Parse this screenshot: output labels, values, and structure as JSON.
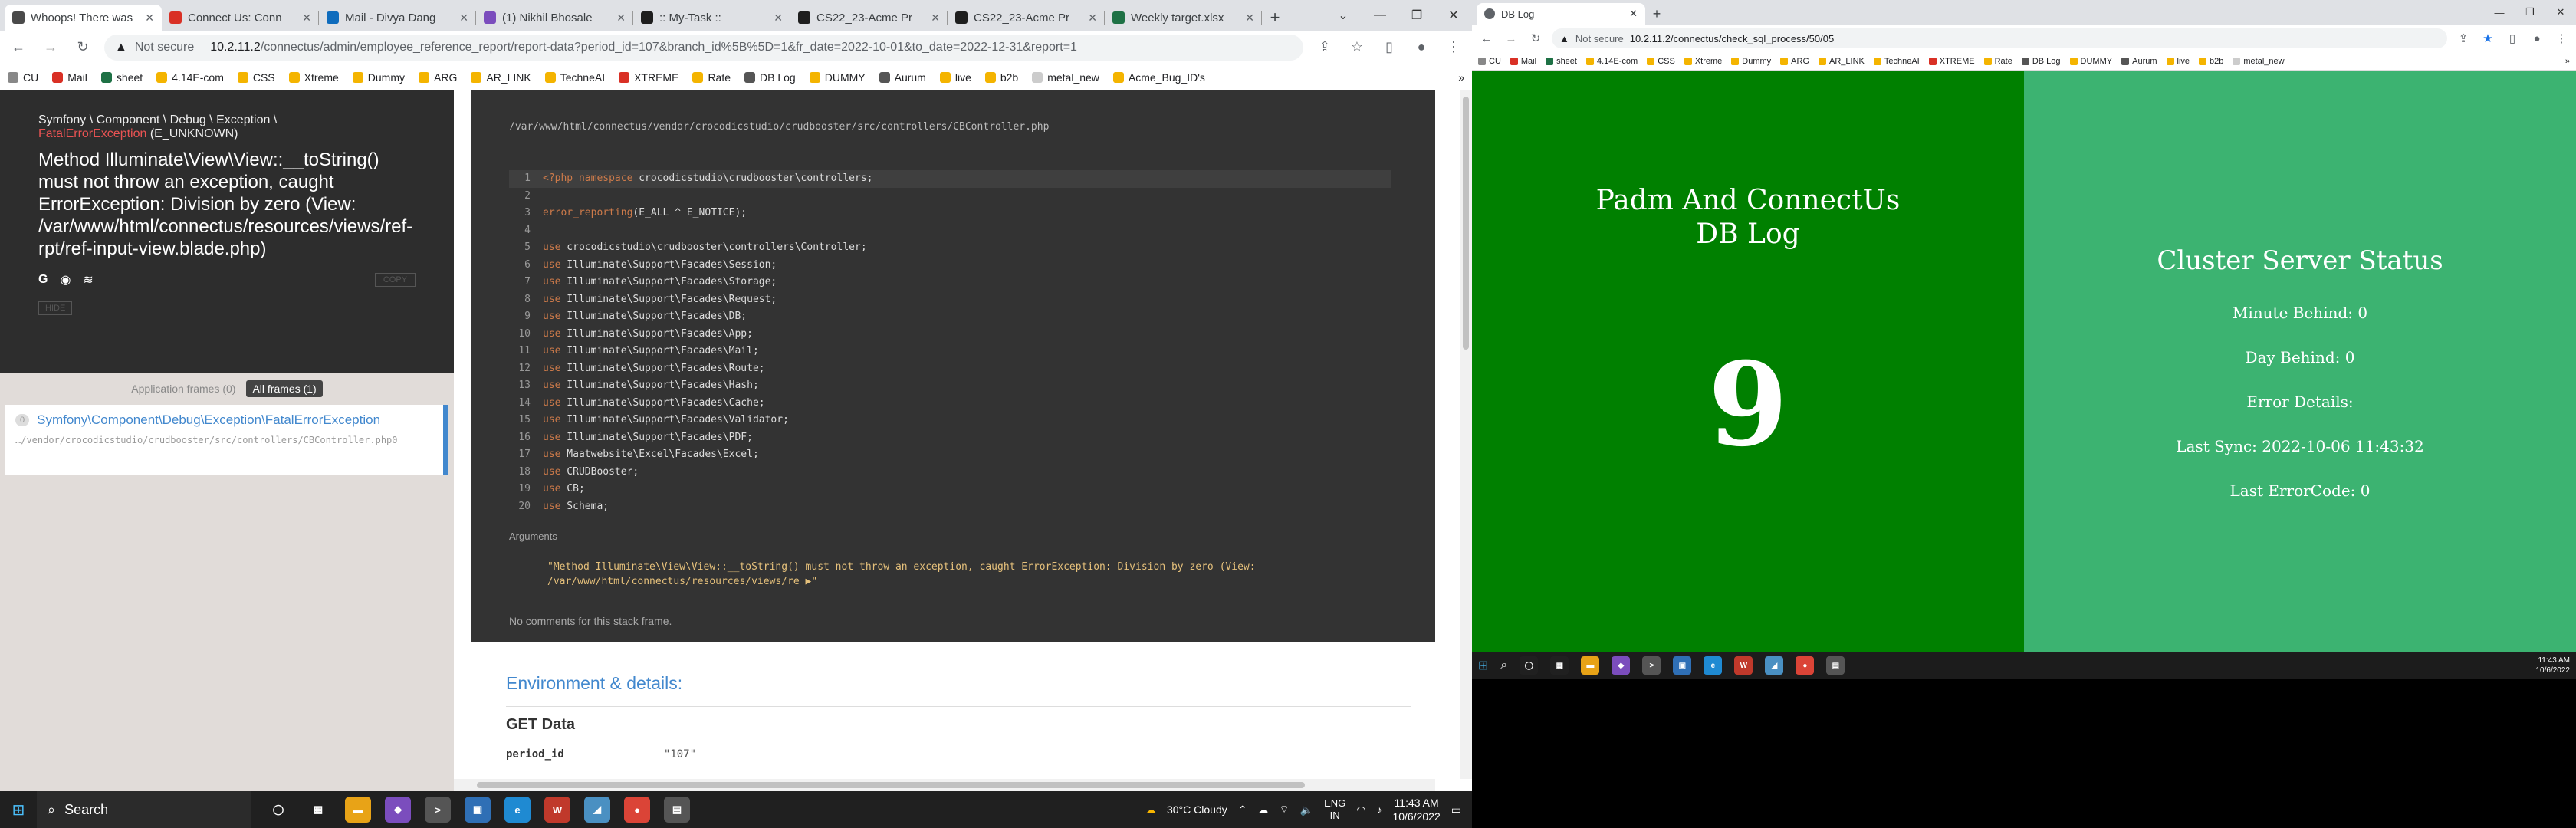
{
  "left_browser": {
    "tabs": [
      {
        "title": "Whoops! There was",
        "color": "#4a4a4a",
        "icon": "chrome-icon",
        "active": true
      },
      {
        "title": "Connect Us: Conn",
        "color": "#d93025",
        "icon": "page-icon"
      },
      {
        "title": "Mail - Divya Dang",
        "color": "#0f6cbd",
        "icon": "outlook-icon"
      },
      {
        "title": "(1) Nikhil Bhosale",
        "color": "#7b4dbd",
        "icon": "teams-icon"
      },
      {
        "title": ":: My-Task ::",
        "color": "#1e1e1e",
        "icon": "task-icon"
      },
      {
        "title": "CS22_23-Acme Pr",
        "color": "#1e1e1e",
        "icon": "page-icon"
      },
      {
        "title": "CS22_23-Acme Pr",
        "color": "#1e1e1e",
        "icon": "page-icon"
      },
      {
        "title": "Weekly target.xlsx",
        "color": "#1e7145",
        "icon": "excel-icon"
      }
    ],
    "window_controls": [
      "⌄",
      "—",
      "❐",
      "✕"
    ],
    "url": {
      "security": "Not secure",
      "host": "10.2.11.2",
      "path": "/connectus/admin/employee_reference_report/report-data?period_id=107&branch_id%5B%5D=1&fr_date=2022-10-01&to_date=2022-12-31&report=1"
    },
    "bookmarks": [
      {
        "label": "CU",
        "color": "#888"
      },
      {
        "label": "Mail",
        "color": "#d93025"
      },
      {
        "label": "sheet",
        "color": "#1e7145"
      },
      {
        "label": "4.14E-com",
        "color": "#f4b400"
      },
      {
        "label": "CSS",
        "color": "#f4b400"
      },
      {
        "label": "Xtreme",
        "color": "#f4b400"
      },
      {
        "label": "Dummy",
        "color": "#f4b400"
      },
      {
        "label": "ARG",
        "color": "#f4b400"
      },
      {
        "label": "AR_LINK",
        "color": "#f4b400"
      },
      {
        "label": "TechneAI",
        "color": "#f4b400"
      },
      {
        "label": "XTREME",
        "color": "#d93025"
      },
      {
        "label": "Rate",
        "color": "#f4b400"
      },
      {
        "label": "DB Log",
        "color": "#555"
      },
      {
        "label": "DUMMY",
        "color": "#f4b400"
      },
      {
        "label": "Aurum",
        "color": "#555"
      },
      {
        "label": "live",
        "color": "#f4b400"
      },
      {
        "label": "b2b",
        "color": "#f4b400"
      },
      {
        "label": "metal_new",
        "color": "#ccc"
      },
      {
        "label": "Acme_Bug_ID's",
        "color": "#f4b400"
      }
    ]
  },
  "whoops": {
    "namespace": "Symfony \\ Component \\ Debug \\ Exception \\",
    "exception_class": "FatalErrorException",
    "exception_code": "(E_UNKNOWN)",
    "message": "Method Illuminate\\View\\View::__toString() must not throw an exception, caught ErrorException: Division by zero (View: /var/www/html/connectus/resources/views/ref-rpt/ref-input-view.blade.php)",
    "copy_label": "COPY",
    "hide_label": "HIDE",
    "frame_tab_app": "Application frames (0)",
    "frame_tab_all": "All frames (1)",
    "frame": {
      "index": "0",
      "title": "Symfony\\Component\\Debug\\Exception\\FatalErrorException",
      "path": "…/vendor/crocodicstudio/crudbooster/src/controllers/CBController.php0"
    },
    "file_path": "/var/www/html/connectus/vendor/crocodicstudio/crudbooster/src/controllers/CBController.php",
    "code_lines": [
      {
        "n": "1",
        "kw": "<?php namespace",
        "text": " crocodicstudio\\crudbooster\\controllers;"
      },
      {
        "n": "2",
        "kw": "",
        "text": ""
      },
      {
        "n": "3",
        "kw": "error_reporting",
        "text": "(E_ALL ^ E_NOTICE);"
      },
      {
        "n": "4",
        "kw": "",
        "text": ""
      },
      {
        "n": "5",
        "kw": "use",
        "text": " crocodicstudio\\crudbooster\\controllers\\Controller;"
      },
      {
        "n": "6",
        "kw": "use",
        "text": " Illuminate\\Support\\Facades\\Session;"
      },
      {
        "n": "7",
        "kw": "use",
        "text": " Illuminate\\Support\\Facades\\Storage;"
      },
      {
        "n": "8",
        "kw": "use",
        "text": " Illuminate\\Support\\Facades\\Request;"
      },
      {
        "n": "9",
        "kw": "use",
        "text": " Illuminate\\Support\\Facades\\DB;"
      },
      {
        "n": "10",
        "kw": "use",
        "text": " Illuminate\\Support\\Facades\\App;"
      },
      {
        "n": "11",
        "kw": "use",
        "text": " Illuminate\\Support\\Facades\\Mail;"
      },
      {
        "n": "12",
        "kw": "use",
        "text": " Illuminate\\Support\\Facades\\Route;"
      },
      {
        "n": "13",
        "kw": "use",
        "text": " Illuminate\\Support\\Facades\\Hash;"
      },
      {
        "n": "14",
        "kw": "use",
        "text": " Illuminate\\Support\\Facades\\Cache;"
      },
      {
        "n": "15",
        "kw": "use",
        "text": " Illuminate\\Support\\Facades\\Validator;"
      },
      {
        "n": "16",
        "kw": "use",
        "text": " Illuminate\\Support\\Facades\\PDF;"
      },
      {
        "n": "17",
        "kw": "use",
        "text": " Maatwebsite\\Excel\\Facades\\Excel;"
      },
      {
        "n": "18",
        "kw": "use",
        "text": " CRUDBooster;"
      },
      {
        "n": "19",
        "kw": "use",
        "text": " CB;"
      },
      {
        "n": "20",
        "kw": "use",
        "text": " Schema;"
      }
    ],
    "arguments_label": "Arguments",
    "argument_text": "\"Method Illuminate\\View\\View::__toString() must not throw an exception, caught ErrorException: Division by zero (View: /var/www/html/connectus/resources/views/re ▶\"",
    "no_comments": "No comments for this stack frame.",
    "env_heading": "Environment & details:",
    "get_heading": "GET Data",
    "get_key": "period_id",
    "get_value": "\"107\""
  },
  "left_taskbar": {
    "search_label": "Search",
    "weather": "30°C  Cloudy",
    "lang_top": "ENG",
    "lang_bottom": "IN",
    "time": "11:43 AM",
    "date": "10/6/2022",
    "apps": [
      {
        "icon": "task-view-icon",
        "color": "#202020",
        "glyph": "◯"
      },
      {
        "icon": "widgets-icon",
        "color": "#202020",
        "glyph": "▦"
      },
      {
        "icon": "file-explorer-icon",
        "color": "#e8a317",
        "glyph": "▬"
      },
      {
        "icon": "visual-studio-icon",
        "color": "#7b4dbd",
        "glyph": "◆"
      },
      {
        "icon": "terminal-icon",
        "color": "#555",
        "glyph": ">"
      },
      {
        "icon": "remote-icon",
        "color": "#2f6fb5",
        "glyph": "▣"
      },
      {
        "icon": "edge-icon",
        "color": "#1f8ad2",
        "glyph": "e"
      },
      {
        "icon": "wps-icon",
        "color": "#c0392b",
        "glyph": "W"
      },
      {
        "icon": "app-icon",
        "color": "#4a90c2",
        "glyph": "◢"
      },
      {
        "icon": "chrome-icon",
        "color": "#db4437",
        "glyph": "●"
      },
      {
        "icon": "calculator-icon",
        "color": "#555",
        "glyph": "▤"
      }
    ]
  },
  "right_browser": {
    "tab_title": "DB Log",
    "url_security": "Not secure",
    "url": "10.2.11.2/connectus/check_sql_process/50/05",
    "bookmarks": [
      {
        "label": "CU",
        "color": "#888"
      },
      {
        "label": "Mail",
        "color": "#d93025"
      },
      {
        "label": "sheet",
        "color": "#1e7145"
      },
      {
        "label": "4.14E-com",
        "color": "#f4b400"
      },
      {
        "label": "CSS",
        "color": "#f4b400"
      },
      {
        "label": "Xtreme",
        "color": "#f4b400"
      },
      {
        "label": "Dummy",
        "color": "#f4b400"
      },
      {
        "label": "ARG",
        "color": "#f4b400"
      },
      {
        "label": "AR_LINK",
        "color": "#f4b400"
      },
      {
        "label": "TechneAI",
        "color": "#f4b400"
      },
      {
        "label": "XTREME",
        "color": "#d93025"
      },
      {
        "label": "Rate",
        "color": "#f4b400"
      },
      {
        "label": "DB Log",
        "color": "#555"
      },
      {
        "label": "DUMMY",
        "color": "#f4b400"
      },
      {
        "label": "Aurum",
        "color": "#555"
      },
      {
        "label": "live",
        "color": "#f4b400"
      },
      {
        "label": "b2b",
        "color": "#f4b400"
      },
      {
        "label": "metal_new",
        "color": "#ccc"
      }
    ]
  },
  "dblog": {
    "title_line1": "Padm And ConnectUs",
    "title_line2": "DB Log",
    "count": "9",
    "status_heading": "Cluster Server Status",
    "minute_behind": "Minute Behind: 0",
    "day_behind": "Day Behind: 0",
    "error_details": "Error Details:",
    "last_sync": "Last Sync: 2022-10-06 11:43:32",
    "last_error_code": "Last ErrorCode: 0",
    "left_color": "#008000",
    "right_color": "#3cb371"
  },
  "right_taskbar": {
    "time": "11:43 AM",
    "date": "10/6/2022"
  }
}
